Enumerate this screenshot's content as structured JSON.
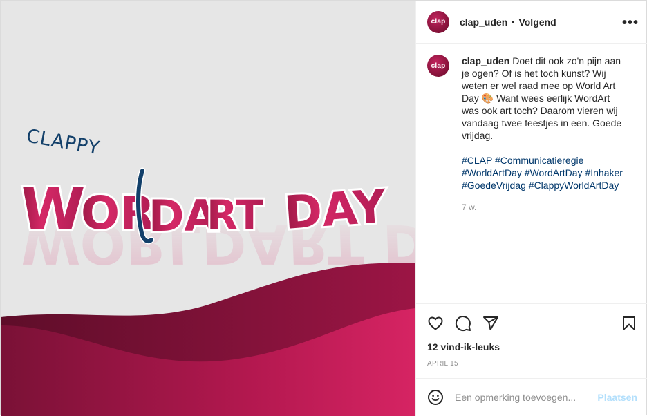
{
  "post": {
    "username": "clap_uden",
    "avatar_text": "clap",
    "follow_label": "Volgend",
    "more_icon": "more-horizontal-icon",
    "caption": {
      "text": "Doet dit ook zo'n pijn aan je ogen? Of is het toch kunst? Wij weten er wel raad mee op World Art Day 🎨 Want wees eerlijk WordArt was ook art toch? Daarom vieren wij vandaag twee feestjes in een. Goede vrijdag.",
      "hashtags": [
        "#CLAP",
        "#Communicatieregie",
        "#WorldArtDay",
        "#WordArtDay",
        "#Inhaker",
        "#GoedeVrijdag",
        "#ClappyWorldArtDay"
      ],
      "age": "7 w."
    },
    "likes": "12 vind-ik-leuks",
    "date": "APRIL 15",
    "comment_placeholder": "Een opmerking toevoegen...",
    "post_label": "Plaatsen"
  },
  "image": {
    "line1": "CLAPPY",
    "line2": "WORLDART DAY",
    "colors": {
      "background": "#e6e6e6",
      "pink": "#d42866",
      "wine": "#7a1136",
      "navy": "#13406a"
    }
  },
  "icons": [
    "heart-icon",
    "comment-icon",
    "share-icon",
    "bookmark-icon",
    "emoji-icon"
  ]
}
